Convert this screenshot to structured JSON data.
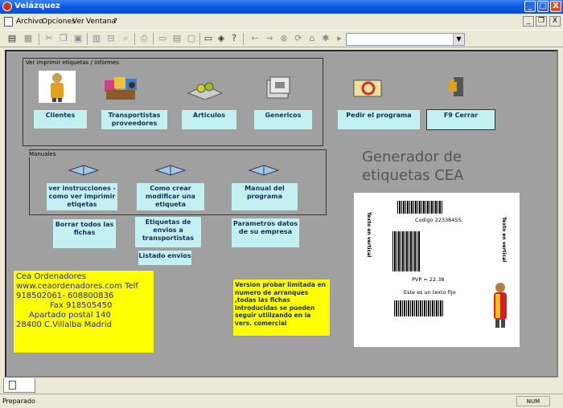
{
  "window": {
    "title": "Velázquez",
    "minimize": "_",
    "maximize": "□",
    "close": "X"
  },
  "menu": {
    "items": [
      "Archivo",
      "Opciones",
      "Ver",
      "Ventana",
      "?"
    ],
    "mdi_min": "_",
    "mdi_restore": "❐",
    "mdi_close": "X"
  },
  "toolbar": {
    "combo_value": ""
  },
  "groups": {
    "print": {
      "label": "Ver imprimir etiquetas / informes"
    },
    "manuals": {
      "label": "Manuales"
    }
  },
  "buttons": {
    "clientes": "Clientes",
    "transportistas": "Transportistas proveedores",
    "articulos": "Articulos",
    "genericos": "Genericos",
    "pedir": "Pedir el programa",
    "cerrar": "F9   Cerrar",
    "ver_instrucciones": "ver instrucciones - como ver imprimir etiqetas",
    "como_crear": "Como crear modificar  una etiqueta",
    "manual": "Manual del programa",
    "borrar": "Borrar todos las fichas",
    "etiquetas_envios": "Etiquetas de envios a transportistas",
    "parametros": "Parametros datos de su empresa",
    "listado": "Listado envios"
  },
  "generator": {
    "title": "Generador de etiquetas CEA",
    "codigo": "Codigo 22338455",
    "pvp": "PVP = 22.38",
    "texto_fijo": "Este es un texto fijo",
    "texto_vertical_left": "Texto en vertical",
    "texto_vertical_right": "Texto en vertical"
  },
  "cea": {
    "line1": "Cea Ordenadores",
    "line2": "www.ceaordenadores.com  Telf",
    "line3": "918502061- 608800836",
    "line4": "Fax 918505450",
    "line5": "Apartado postal 140",
    "line6": "28400 C.Villalba Madrid"
  },
  "promo": {
    "text": "Version probar limitada en numero de arranques ,todas las fichas introducidas se pueden seguir utilizando en la vers. comercial"
  },
  "status": {
    "text": "Preparado",
    "num": "NUM"
  }
}
